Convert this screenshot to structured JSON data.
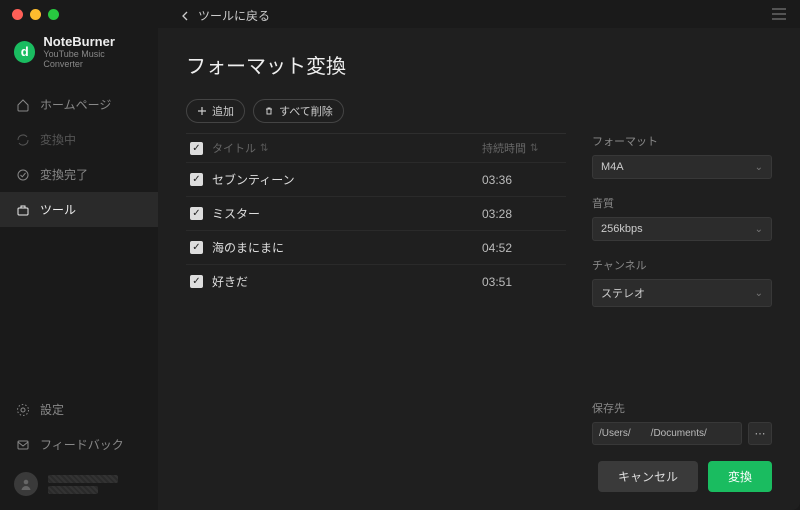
{
  "traffic": {
    "close": "#ff5f57",
    "min": "#febc2e",
    "max": "#28c840"
  },
  "brand": {
    "name": "NoteBurner",
    "sub": "YouTube Music Converter",
    "logo_letter": "d"
  },
  "back": {
    "label": "ツールに戻る"
  },
  "page": {
    "title": "フォーマット変換"
  },
  "sidebar": {
    "items": [
      {
        "label": "ホームページ"
      },
      {
        "label": "変換中"
      },
      {
        "label": "変換完了"
      },
      {
        "label": "ツール"
      }
    ],
    "settings": "設定",
    "feedback": "フィードバック"
  },
  "toolbar": {
    "add": "追加",
    "delete_all": "すべて削除"
  },
  "table": {
    "header_title": "タイトル",
    "header_duration": "持続時間",
    "rows": [
      {
        "title": "セブンティーン",
        "duration": "03:36"
      },
      {
        "title": "ミスター",
        "duration": "03:28"
      },
      {
        "title": "海のまにまに",
        "duration": "04:52"
      },
      {
        "title": "好きだ",
        "duration": "03:51"
      }
    ]
  },
  "form": {
    "format_label": "フォーマット",
    "format_value": "M4A",
    "quality_label": "音質",
    "quality_value": "256kbps",
    "channel_label": "チャンネル",
    "channel_value": "ステレオ",
    "save_label": "保存先",
    "save_path_a": "/Users/",
    "save_path_b": "/Documents/"
  },
  "footer": {
    "cancel": "キャンセル",
    "convert": "変換"
  }
}
